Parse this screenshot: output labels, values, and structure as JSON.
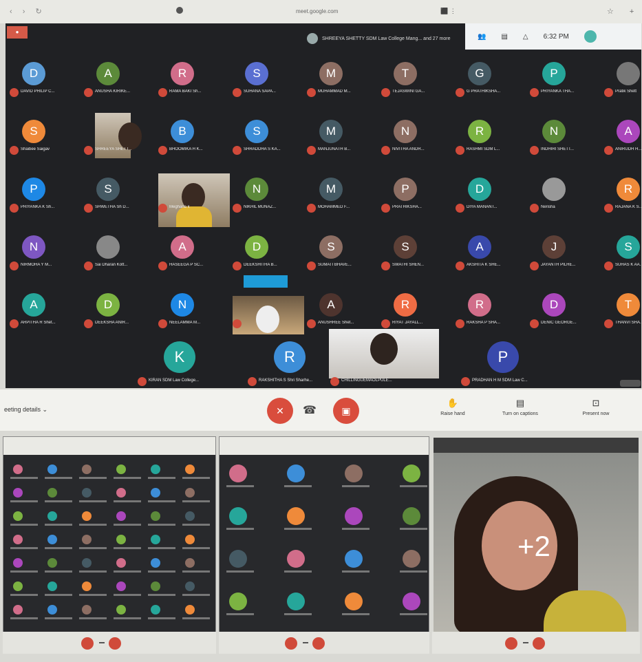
{
  "browser": {
    "url": "meet.google.com"
  },
  "meet": {
    "presenter": "SHREEYA SHETTY SDM Law College Mang... and 27 more",
    "time": "6:32 PM",
    "participants": [
      {
        "initial": "D",
        "name": "DAVID PHILIP C...",
        "color": "#5b9bd5"
      },
      {
        "initial": "A",
        "name": "ANUSHA KIRIKE...",
        "color": "#5c8a3a"
      },
      {
        "initial": "R",
        "name": "RAMA BAKI Sh...",
        "color": "#d16d8a"
      },
      {
        "initial": "S",
        "name": "SUHANA SAPA...",
        "color": "#5a6fd1"
      },
      {
        "initial": "M",
        "name": "MUHAMMAD M...",
        "color": "#8d6e63"
      },
      {
        "initial": "T",
        "name": "TEJASWINI GA...",
        "color": "#8d6e63"
      },
      {
        "initial": "G",
        "name": "G PRATHIKSHA...",
        "color": "#455a64"
      },
      {
        "initial": "P",
        "name": "PRIYANKA THA...",
        "color": "#26a69a"
      },
      {
        "initial": "",
        "name": "Pratik Shett",
        "color": "#777"
      },
      {
        "initial": "S",
        "name": "Shaibee Saigav",
        "color": "#ef8a3a"
      },
      {
        "initial": "",
        "name": "SHREEYA SHETT...",
        "color": "#777"
      },
      {
        "initial": "B",
        "name": "BHOOMIKA H K...",
        "color": "#3d8ed8"
      },
      {
        "initial": "S",
        "name": "SHRADDHA S KA...",
        "color": "#3d8ed8"
      },
      {
        "initial": "M",
        "name": "MANJUNATH B...",
        "color": "#455a64"
      },
      {
        "initial": "N",
        "name": "NIVITHA ANDR...",
        "color": "#8d6e63"
      },
      {
        "initial": "R",
        "name": "RASHMI SDM L...",
        "color": "#7cb342"
      },
      {
        "initial": "N",
        "name": "INDHIRI SHETT...",
        "color": "#5c8a3a"
      },
      {
        "initial": "A",
        "name": "ANIRUDH H...",
        "color": "#ab47bc"
      },
      {
        "initial": "P",
        "name": "PRIYANKA K Sh...",
        "color": "#1e88e5"
      },
      {
        "initial": "S",
        "name": "SHWETHA Sh D...",
        "color": "#455a64"
      },
      {
        "initial": "",
        "name": "Meghana k",
        "color": "#777"
      },
      {
        "initial": "N",
        "name": "NIKHIL MUNAZ...",
        "color": "#5c8a3a"
      },
      {
        "initial": "M",
        "name": "MOHAMMED F...",
        "color": "#455a64"
      },
      {
        "initial": "P",
        "name": "PRATHIKSHA...",
        "color": "#8d6e63"
      },
      {
        "initial": "D",
        "name": "DIYA MANANT...",
        "color": "#26a69a"
      },
      {
        "initial": "",
        "name": "Nerisha",
        "color": "#999"
      },
      {
        "initial": "R",
        "name": "RAJANA K S...",
        "color": "#ef8a3a"
      },
      {
        "initial": "N",
        "name": "NIRMOHA Y M...",
        "color": "#7e57c2"
      },
      {
        "initial": "",
        "name": "Sai Dharan Kott...",
        "color": "#888"
      },
      {
        "initial": "A",
        "name": "HASEEGA P SC...",
        "color": "#d16d8a"
      },
      {
        "initial": "D",
        "name": "DEEKSHITHA B...",
        "color": "#7cb342"
      },
      {
        "initial": "S",
        "name": "SUMATI BHAVE...",
        "color": "#8d6e63"
      },
      {
        "initial": "S",
        "name": "SWATHI SHEN...",
        "color": "#5d4037"
      },
      {
        "initial": "A",
        "name": "AKSHITA K SHE...",
        "color": "#3949ab"
      },
      {
        "initial": "J",
        "name": "JAYANTH PILHE...",
        "color": "#5d4037"
      },
      {
        "initial": "S",
        "name": "SUHAS K AA...",
        "color": "#26a69a"
      },
      {
        "initial": "A",
        "name": "ARPITHA R Shet...",
        "color": "#26a69a"
      },
      {
        "initial": "D",
        "name": "DEEKSHA ANIR...",
        "color": "#7cb342"
      },
      {
        "initial": "N",
        "name": "NEELAMMA M...",
        "color": "#1e88e5"
      },
      {
        "initial": "",
        "name": "",
        "color": "#777"
      },
      {
        "initial": "A",
        "name": "ANUSHREE Shet...",
        "color": "#4e342e"
      },
      {
        "initial": "R",
        "name": "RIYAT JAYALL...",
        "color": "#ef6c44"
      },
      {
        "initial": "R",
        "name": "RAKSHA P SHA...",
        "color": "#d16d8a"
      },
      {
        "initial": "D",
        "name": "DENIC GEORGE...",
        "color": "#ab47bc"
      },
      {
        "initial": "T",
        "name": "THANVI SHA...",
        "color": "#ef8a3a"
      }
    ],
    "bottom_row": [
      {
        "initial": "K",
        "name": "KIRAN SDM Law College...",
        "color": "#26a69a"
      },
      {
        "initial": "R",
        "name": "RAKSHITHA S Shri Sharhe...",
        "color": "#3d8ed8"
      },
      {
        "initial": "",
        "name": "CHILLINGUEMAOLPULE...",
        "color": "#777"
      },
      {
        "initial": "P",
        "name": "PRADHAN H M SDM Law C...",
        "color": "#3949ab"
      }
    ]
  },
  "controls": {
    "meeting_details": "eeting details",
    "raise_hand": "Raise hand",
    "captions": "Turn on captions",
    "present": "Present now"
  },
  "overflow_count": "+2"
}
